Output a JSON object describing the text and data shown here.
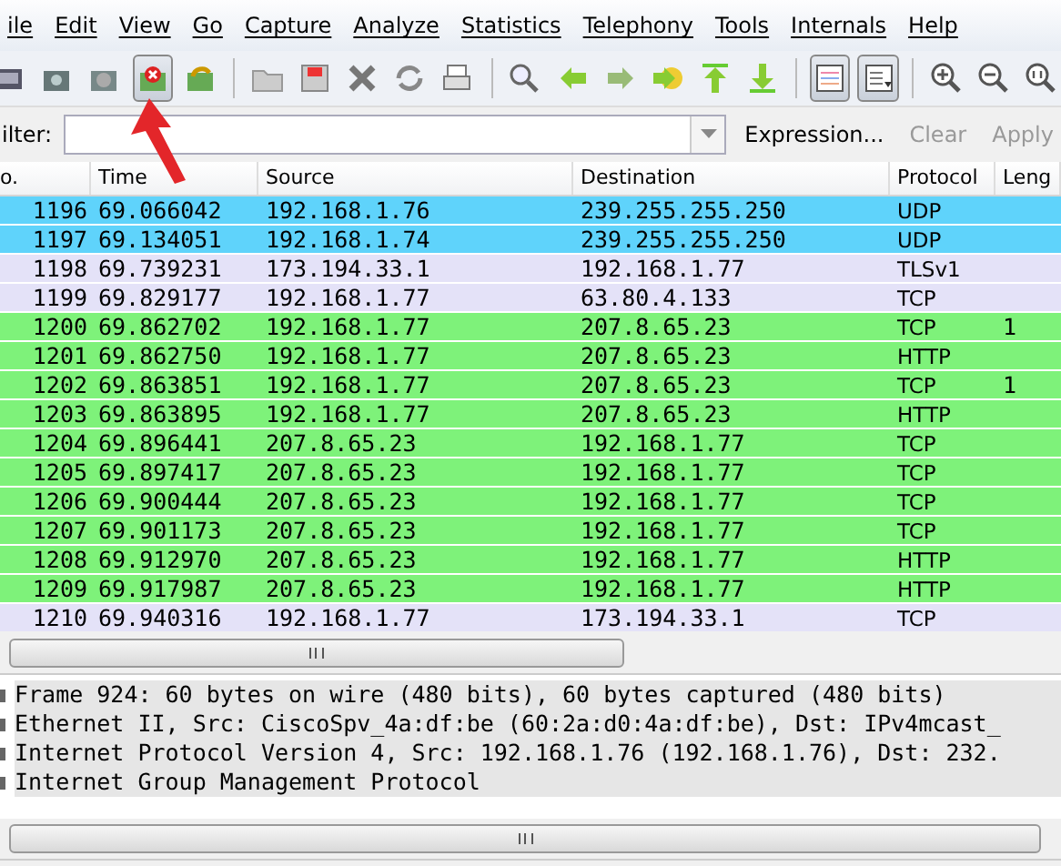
{
  "menu": [
    "ile",
    "Edit",
    "View",
    "Go",
    "Capture",
    "Analyze",
    "Statistics",
    "Telephony",
    "Tools",
    "Internals",
    "Help"
  ],
  "toolbar": {
    "toggles": [
      {
        "on": true
      },
      {
        "on": true
      }
    ]
  },
  "filter": {
    "label": "ilter:",
    "buttons": [
      {
        "label": "Expression...",
        "disabled": false
      },
      {
        "label": "Clear",
        "disabled": true
      },
      {
        "label": "Apply",
        "disabled": true
      }
    ]
  },
  "packet_list": {
    "columns": [
      "o.",
      "Time",
      "Source",
      "Destination",
      "Protocol",
      "Leng"
    ],
    "rows": [
      {
        "no": "1196",
        "time": "69.066042",
        "source": "192.168.1.76",
        "destination": "239.255.255.250",
        "protocol": "UDP",
        "color": "#5fd3fb"
      },
      {
        "no": "1197",
        "time": "69.134051",
        "source": "192.168.1.74",
        "destination": "239.255.255.250",
        "protocol": "UDP",
        "color": "#5fd3fb"
      },
      {
        "no": "1198",
        "time": "69.739231",
        "source": "173.194.33.1",
        "destination": "192.168.1.77",
        "protocol": "TLSv1",
        "color": "#e4e2f8"
      },
      {
        "no": "1199",
        "time": "69.829177",
        "source": "192.168.1.77",
        "destination": "63.80.4.133",
        "protocol": "TCP",
        "color": "#e4e2f8"
      },
      {
        "no": "1200",
        "time": "69.862702",
        "source": "192.168.1.77",
        "destination": "207.8.65.23",
        "protocol": "TCP",
        "length": "1",
        "color": "#7ef27a"
      },
      {
        "no": "1201",
        "time": "69.862750",
        "source": "192.168.1.77",
        "destination": "207.8.65.23",
        "protocol": "HTTP",
        "color": "#7ef27a"
      },
      {
        "no": "1202",
        "time": "69.863851",
        "source": "192.168.1.77",
        "destination": "207.8.65.23",
        "protocol": "TCP",
        "length": "1",
        "color": "#7ef27a"
      },
      {
        "no": "1203",
        "time": "69.863895",
        "source": "192.168.1.77",
        "destination": "207.8.65.23",
        "protocol": "HTTP",
        "color": "#7ef27a"
      },
      {
        "no": "1204",
        "time": "69.896441",
        "source": "207.8.65.23",
        "destination": "192.168.1.77",
        "protocol": "TCP",
        "color": "#7ef27a"
      },
      {
        "no": "1205",
        "time": "69.897417",
        "source": "207.8.65.23",
        "destination": "192.168.1.77",
        "protocol": "TCP",
        "color": "#7ef27a"
      },
      {
        "no": "1206",
        "time": "69.900444",
        "source": "207.8.65.23",
        "destination": "192.168.1.77",
        "protocol": "TCP",
        "color": "#7ef27a"
      },
      {
        "no": "1207",
        "time": "69.901173",
        "source": "207.8.65.23",
        "destination": "192.168.1.77",
        "protocol": "TCP",
        "color": "#7ef27a"
      },
      {
        "no": "1208",
        "time": "69.912970",
        "source": "207.8.65.23",
        "destination": "192.168.1.77",
        "protocol": "HTTP",
        "color": "#7ef27a"
      },
      {
        "no": "1209",
        "time": "69.917987",
        "source": "207.8.65.23",
        "destination": "192.168.1.77",
        "protocol": "HTTP",
        "color": "#7ef27a"
      },
      {
        "no": "1210",
        "time": "69.940316",
        "source": "192.168.1.77",
        "destination": "173.194.33.1",
        "protocol": "TCP",
        "color": "#e4e2f8"
      }
    ]
  },
  "details": [
    "Frame 924: 60 bytes on wire (480 bits), 60 bytes captured (480 bits)",
    "Ethernet II, Src: CiscoSpv_4a:df:be (60:2a:d0:4a:df:be), Dst: IPv4mcast_",
    "Internet Protocol Version 4, Src: 192.168.1.76 (192.168.1.76), Dst: 232.",
    "Internet Group Management Protocol"
  ]
}
